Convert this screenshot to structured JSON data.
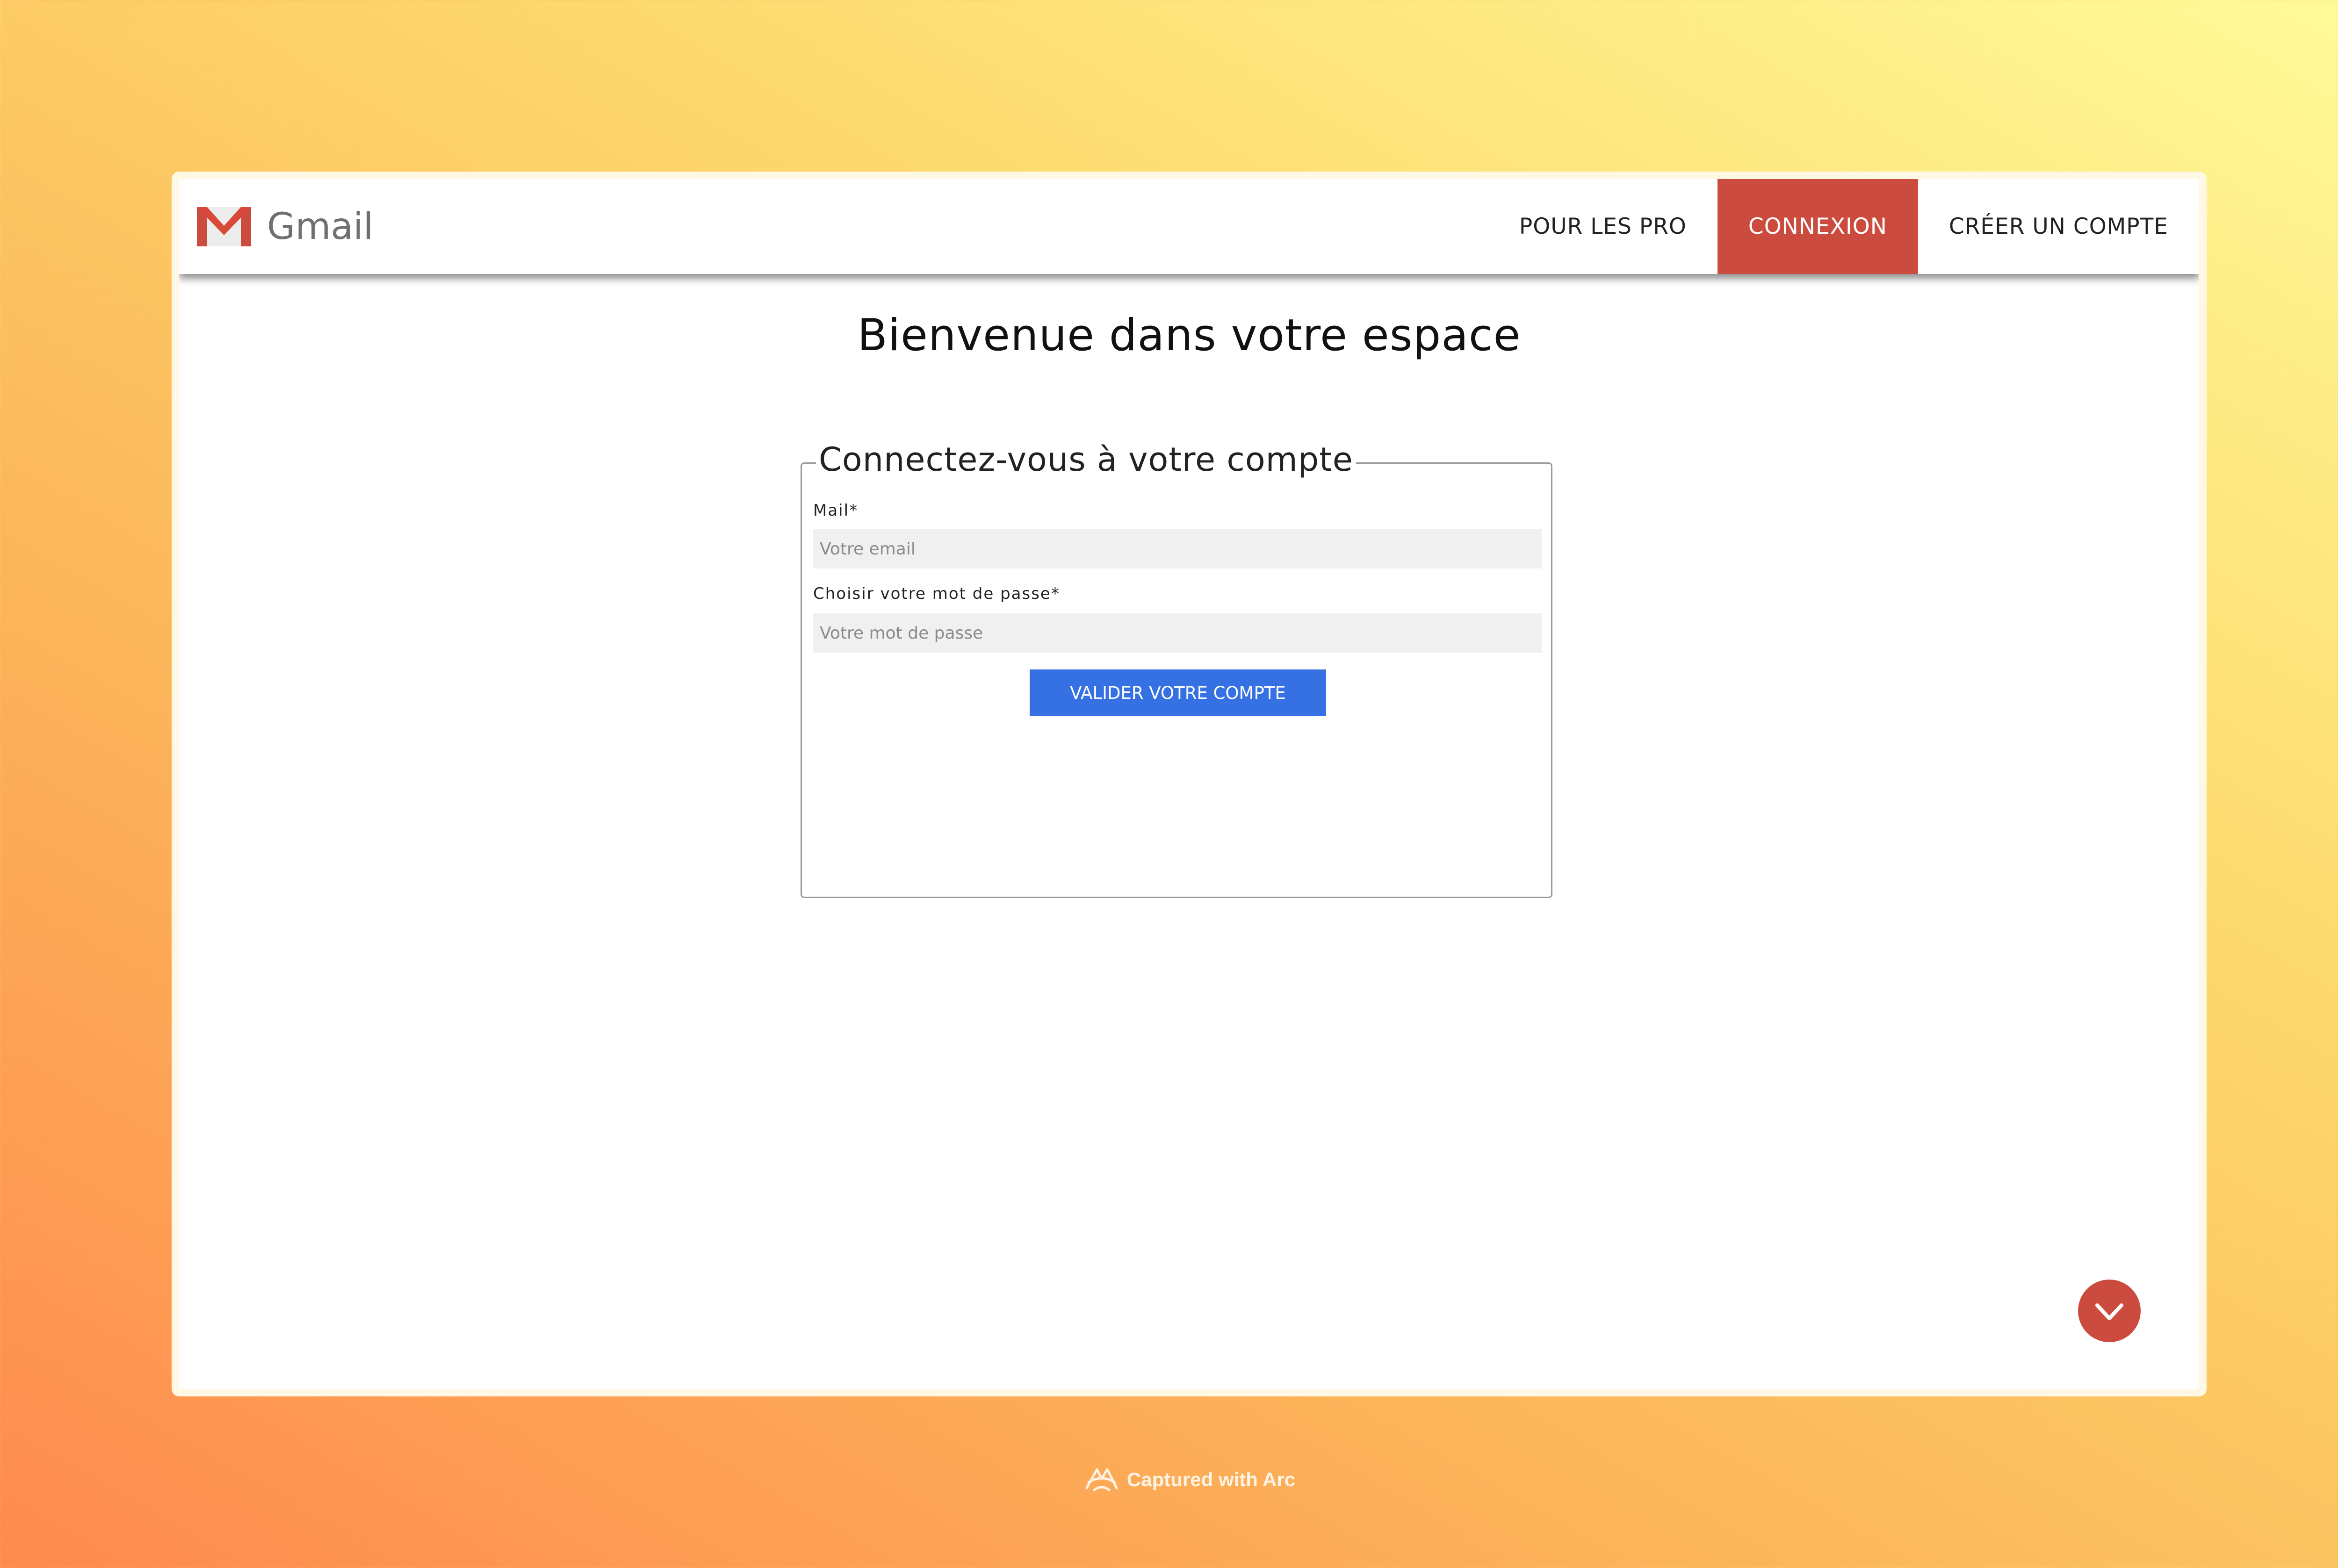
{
  "colors": {
    "brand_red": "#cb4c3f",
    "button_blue": "#3571e3",
    "input_bg": "#f0f0f0"
  },
  "navbar": {
    "logo_icon": "gmail-m-logo-icon",
    "brand_name": "Gmail",
    "links": [
      {
        "label": "POUR LES PRO",
        "active": false
      },
      {
        "label": "CONNEXION",
        "active": true
      },
      {
        "label": "CRÉER UN COMPTE",
        "active": false
      }
    ]
  },
  "main": {
    "title": "Bienvenue dans votre espace"
  },
  "login_form": {
    "legend": "Connectez-vous à votre compte",
    "email": {
      "label": "Mail*",
      "placeholder": "Votre email",
      "value": ""
    },
    "password": {
      "label": "Choisir votre mot de passe*",
      "placeholder": "Votre mot de passe",
      "value": ""
    },
    "submit_label": "VALIDER VOTRE COMPTE"
  },
  "scroll_button": {
    "icon": "chevron-down-icon"
  },
  "footer": {
    "capture_text": "Captured with Arc",
    "icon": "arc-logo-icon"
  }
}
